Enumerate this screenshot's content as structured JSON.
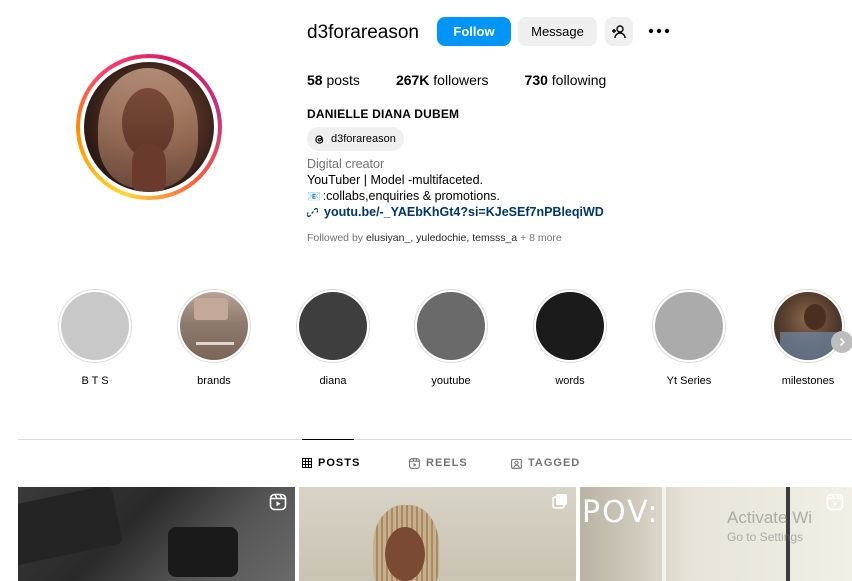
{
  "profile": {
    "username": "d3forareason",
    "follow_label": "Follow",
    "message_label": "Message",
    "stats": {
      "posts_count": "58",
      "posts_label": "posts",
      "followers_count": "267K",
      "followers_label": "followers",
      "following_count": "730",
      "following_label": "following"
    },
    "full_name": "DANIELLE DIANA DUBEM",
    "threads_handle": "d3forareason",
    "category": "Digital creator",
    "bio_line1": "YouTuber | Model -multifaceted.",
    "bio_line2_emoji": "📧",
    "bio_line2": ":collabs,enquiries & promotions.",
    "link": "youtu.be/-_YAEbKhGt4?si=KJeSEf7nPBleqiWD",
    "followed_by_prefix": "Followed by ",
    "followed_by_names": "elusiyan_, yuledochie, temsss_a",
    "followed_by_more": " + 8 more"
  },
  "highlights": [
    {
      "label": "B T S",
      "color": "#c8c8c8"
    },
    {
      "label": "brands",
      "color": "#9a8779"
    },
    {
      "label": "diana",
      "color": "#3e3e3e"
    },
    {
      "label": "youtube",
      "color": "#6a6a6a"
    },
    {
      "label": "words",
      "color": "#1b1b1b"
    },
    {
      "label": "Yt Series",
      "color": "#ababab"
    },
    {
      "label": "milestones",
      "color": "#4a3628"
    }
  ],
  "tabs": {
    "posts": "POSTS",
    "reels": "REELS",
    "tagged": "TAGGED"
  },
  "posts": {
    "post3_text": "POV:",
    "watermark_title": "Activate Wi",
    "watermark_sub": "Go to Settings"
  },
  "colors": {
    "accent": "#0095f6",
    "link": "#00376b",
    "muted": "#737373"
  }
}
